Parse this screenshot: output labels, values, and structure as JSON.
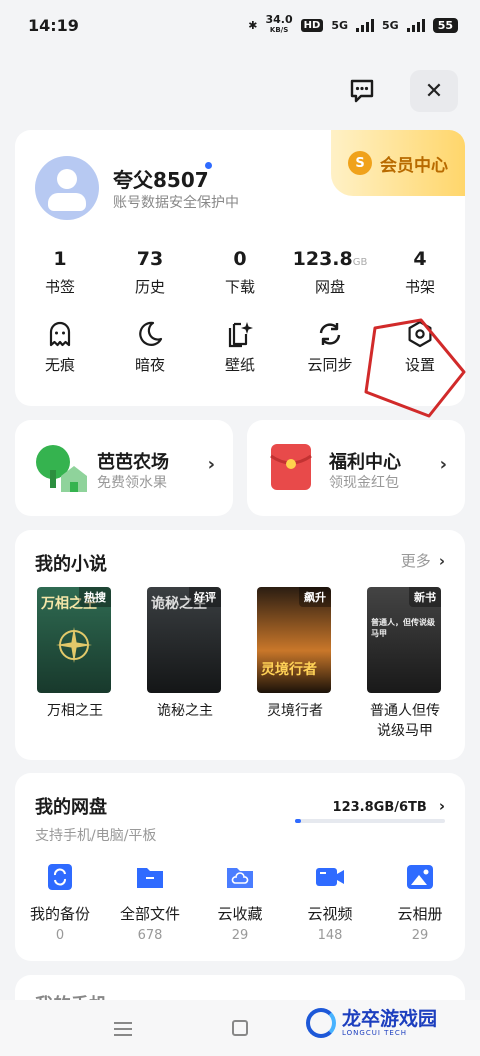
{
  "status_bar": {
    "time": "14:19",
    "speed": "34.0",
    "speed_unit": "KB/S",
    "hd": "HD",
    "net1": "5G",
    "net2": "5G",
    "battery": "55"
  },
  "profile": {
    "username": "夸父8507",
    "security_note": "账号数据安全保护中",
    "vip_label": "会员中心",
    "vip_coin": "S"
  },
  "stats": [
    {
      "value": "1",
      "unit": "",
      "label": "书签"
    },
    {
      "value": "73",
      "unit": "",
      "label": "历史"
    },
    {
      "value": "0",
      "unit": "",
      "label": "下载"
    },
    {
      "value": "123.8",
      "unit": "GB",
      "label": "网盘"
    },
    {
      "value": "4",
      "unit": "",
      "label": "书架"
    }
  ],
  "tools": [
    {
      "label": "无痕",
      "icon": "ghost-icon"
    },
    {
      "label": "暗夜",
      "icon": "moon-icon"
    },
    {
      "label": "壁纸",
      "icon": "wallpaper-icon"
    },
    {
      "label": "云同步",
      "icon": "sync-icon"
    },
    {
      "label": "设置",
      "icon": "settings-icon"
    }
  ],
  "promos": {
    "farm": {
      "title": "芭芭农场",
      "sub": "免费领水果",
      "arrow": "›"
    },
    "welfare": {
      "title": "福利中心",
      "sub": "领现金红包",
      "arrow": "›"
    }
  },
  "novels": {
    "title": "我的小说",
    "more": "更多",
    "arrow": "›",
    "books": [
      {
        "title": "万相之王",
        "tag": "热搜",
        "cover_text": "万相之王"
      },
      {
        "title": "诡秘之主",
        "tag": "好评",
        "cover_text": "诡秘之主"
      },
      {
        "title": "灵境行者",
        "tag": "飙升",
        "cover_text": "灵境行者"
      },
      {
        "title": "普通人但传说级马甲",
        "tag": "新书",
        "cover_text": "普通人，但传说级马甲"
      }
    ]
  },
  "disk": {
    "title": "我的网盘",
    "sub": "支持手机/电脑/平板",
    "storage": "123.8GB/6TB",
    "arrow": "›",
    "used_fraction": 0.02,
    "items": [
      {
        "label": "我的备份",
        "count": "0",
        "icon": "backup-icon"
      },
      {
        "label": "全部文件",
        "count": "678",
        "icon": "folder-icon"
      },
      {
        "label": "云收藏",
        "count": "29",
        "icon": "cloud-folder-icon"
      },
      {
        "label": "云视频",
        "count": "148",
        "icon": "video-icon"
      },
      {
        "label": "云相册",
        "count": "29",
        "icon": "photo-icon"
      }
    ]
  },
  "peek_title": "我的手机",
  "watermark": {
    "text": "龙卒游戏园",
    "sub": "LONGCUI TECH"
  },
  "colors": {
    "accent": "#2f6bff",
    "vip": "#b86a00",
    "annotation": "#d12a2a",
    "farm": "#35b34f",
    "welfare": "#e84a4a"
  }
}
